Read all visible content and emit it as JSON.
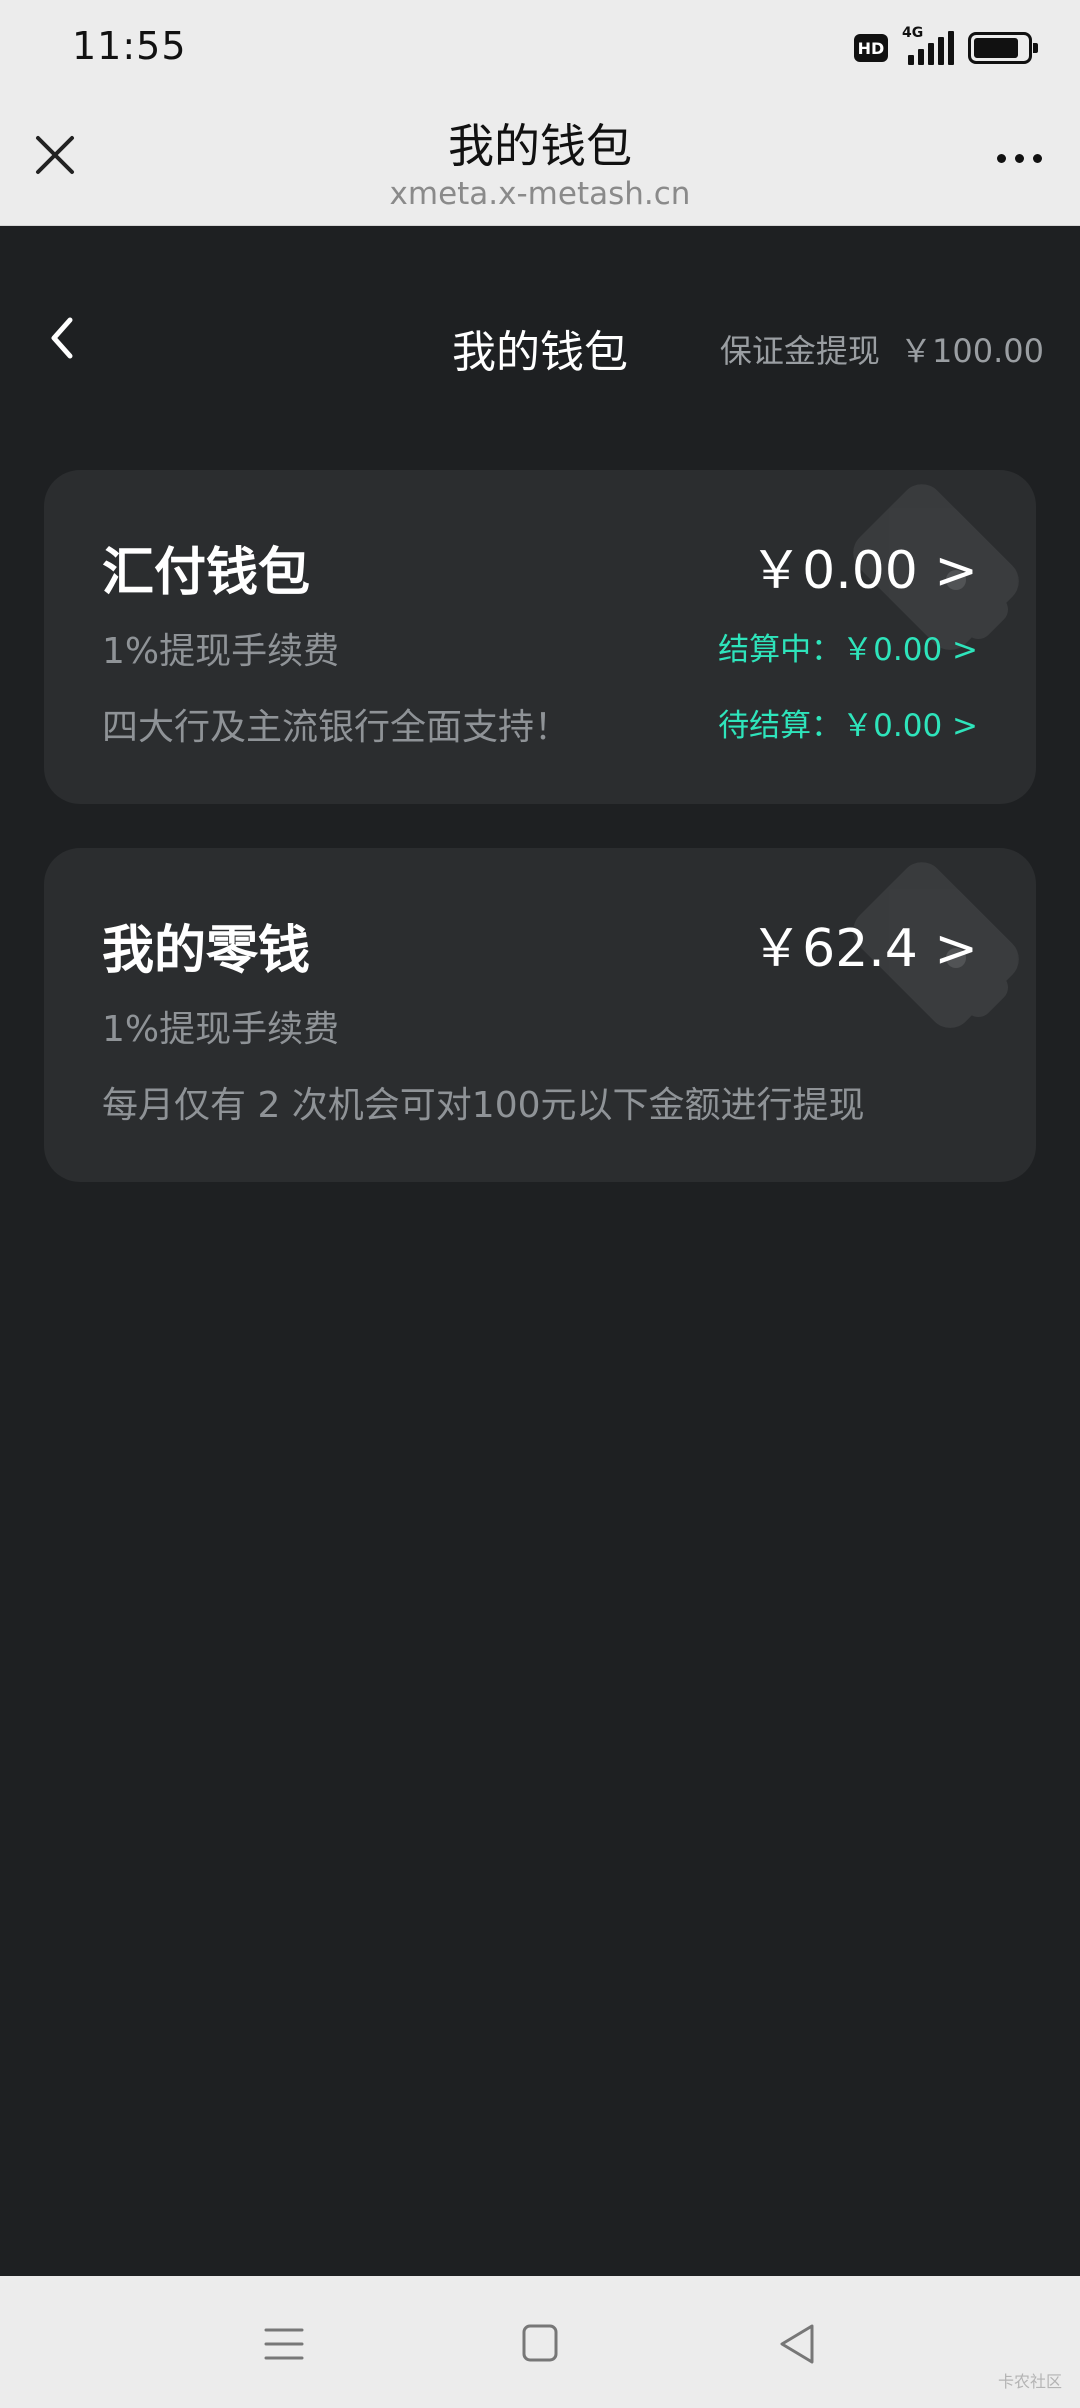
{
  "status_bar": {
    "time": "11:55",
    "hd_badge": "HD",
    "network_type": "4G",
    "battery_percent": 85
  },
  "browser": {
    "title": "我的钱包",
    "url": "xmeta.x-metash.cn",
    "close_icon": "close-icon",
    "more_icon": "more-dots-icon"
  },
  "page": {
    "title": "我的钱包",
    "deposit_label": "保证金提现",
    "deposit_amount": "￥100.00",
    "back_icon": "chevron-left-icon"
  },
  "cards": {
    "huifu": {
      "name": "汇付钱包",
      "amount": "￥0.00 >",
      "fee": "1%提现手续费",
      "support": "四大行及主流银行全面支持！",
      "settling": "结算中：￥0.00 >",
      "pending": "待结算：￥0.00 >"
    },
    "change": {
      "name": "我的零钱",
      "amount": "￥62.4 >",
      "fee": "1%提现手续费",
      "note": "每月仅有 2 次机会可对100元以下金额进行提现"
    }
  },
  "colors": {
    "background": "#1e2022",
    "card": "#2b2d2f",
    "accent": "#2ee4bb",
    "muted_text": "#8f9397",
    "system_bar": "#ececec"
  },
  "nav_bar": {
    "menu_icon": "menu-icon",
    "home_icon": "home-square-icon",
    "back_icon": "back-triangle-icon",
    "watermark": "卡农社区"
  }
}
